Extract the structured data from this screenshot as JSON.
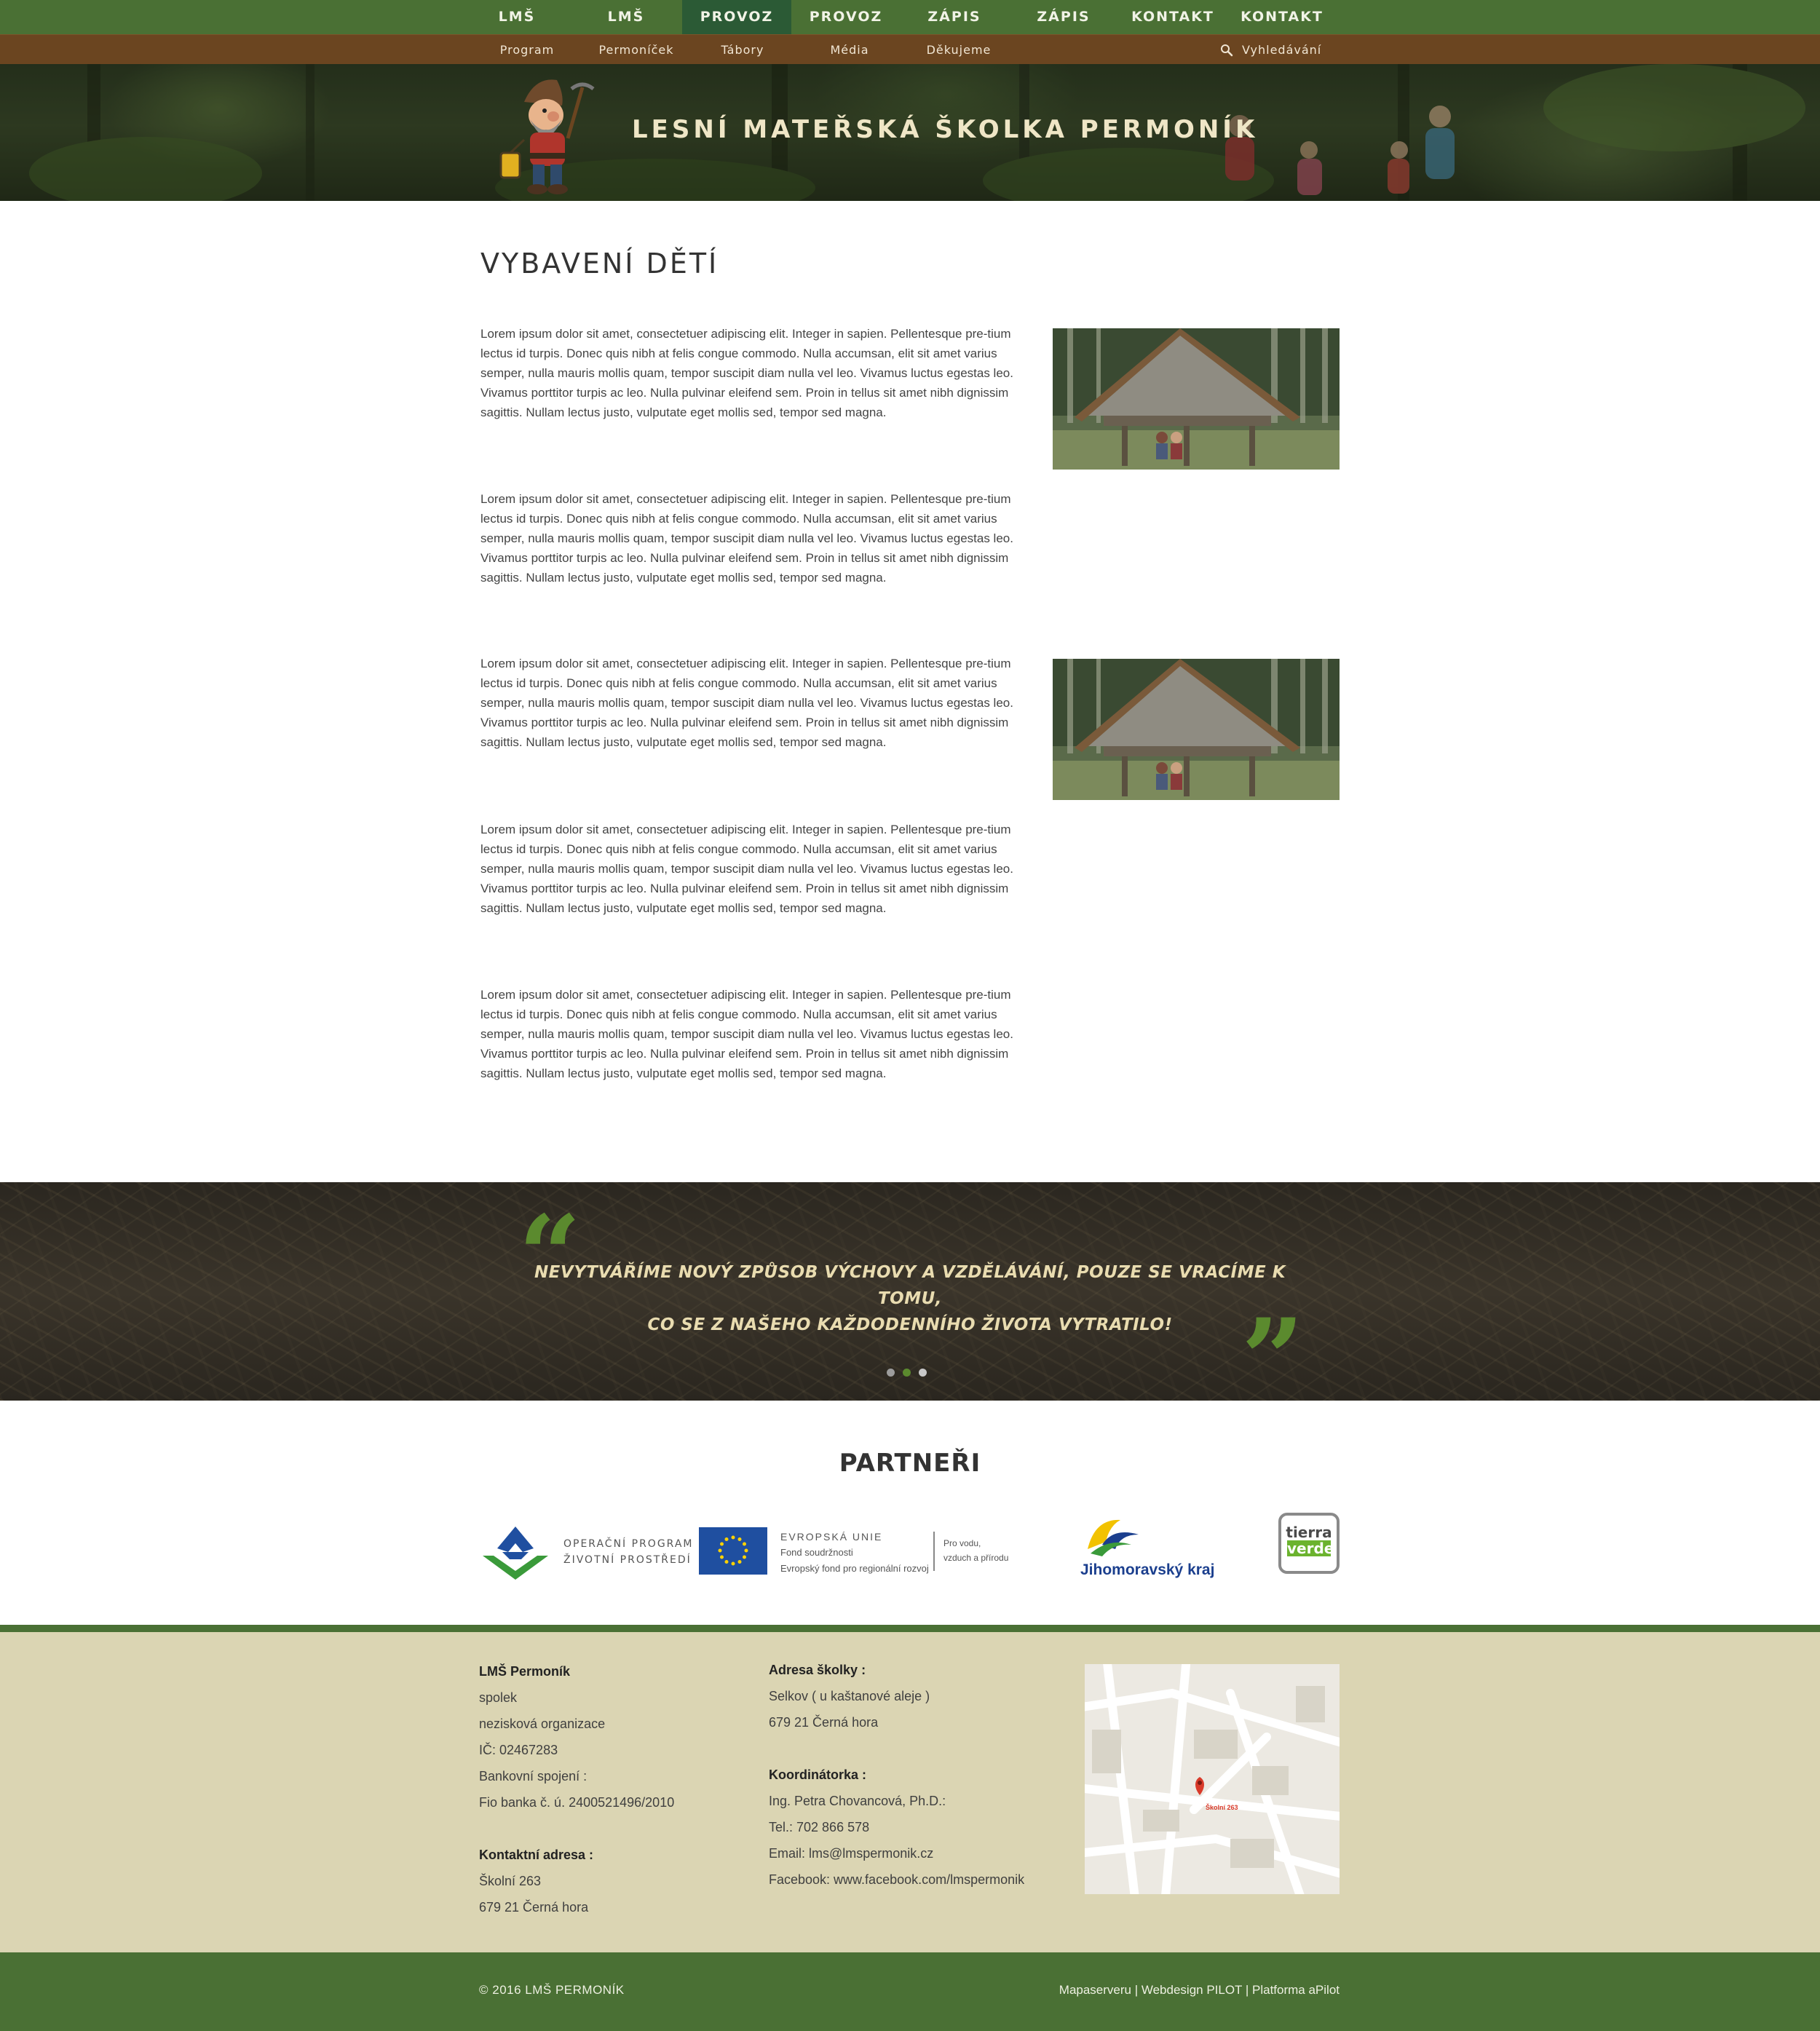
{
  "topnav": {
    "items": [
      "LMŠ",
      "LMŠ",
      "PROVOZ",
      "PROVOZ",
      "ZÁPIS",
      "ZÁPIS",
      "KONTAKT",
      "KONTAKT"
    ],
    "active_index": 2
  },
  "subnav": {
    "items": [
      "Program",
      "Permoníček",
      "Tábory",
      "Média",
      "Děkujeme"
    ],
    "search_label": "Vyhledávání"
  },
  "header": {
    "title": "LESNÍ MATEŘSKÁ ŠKOLKA PERMONÍK"
  },
  "content": {
    "title": "VYBAVENÍ DĚTÍ",
    "paragraphs": [
      "Lorem ipsum dolor sit amet, consectetuer adipiscing elit. Integer in sapien. Pellentesque pre-tium lectus id turpis. Donec quis nibh at felis congue commodo. Nulla accumsan, elit sit amet varius semper, nulla mauris mollis quam, tempor suscipit diam nulla vel leo. Vivamus luctus egestas leo. Vivamus porttitor turpis ac leo. Nulla pulvinar eleifend sem. Proin in tellus sit amet nibh dignissim sagittis. Nullam lectus justo, vulputate eget mollis sed, tempor sed magna.",
      "Lorem ipsum dolor sit amet, consectetuer adipiscing elit. Integer in sapien. Pellentesque pre-tium lectus id turpis. Donec quis nibh at felis congue commodo. Nulla accumsan, elit sit amet varius semper, nulla mauris mollis quam, tempor suscipit diam nulla vel leo. Vivamus luctus egestas leo. Vivamus porttitor turpis ac leo. Nulla pulvinar eleifend sem. Proin in tellus sit amet nibh dignissim sagittis. Nullam lectus justo, vulputate eget mollis sed, tempor sed magna.",
      "Lorem ipsum dolor sit amet, consectetuer adipiscing elit. Integer in sapien. Pellentesque pre-tium lectus id turpis. Donec quis nibh at felis congue commodo. Nulla accumsan, elit sit amet varius semper, nulla mauris mollis quam, tempor suscipit diam nulla vel leo. Vivamus luctus egestas leo. Vivamus porttitor turpis ac leo. Nulla pulvinar eleifend sem. Proin in tellus sit amet nibh dignissim sagittis. Nullam lectus justo, vulputate eget mollis sed, tempor sed magna.",
      "Lorem ipsum dolor sit amet, consectetuer adipiscing elit. Integer in sapien. Pellentesque pre-tium lectus id turpis. Donec quis nibh at felis congue commodo. Nulla accumsan, elit sit amet varius semper, nulla mauris mollis quam, tempor suscipit diam nulla vel leo. Vivamus luctus egestas leo. Vivamus porttitor turpis ac leo. Nulla pulvinar eleifend sem. Proin in tellus sit amet nibh dignissim sagittis. Nullam lectus justo, vulputate eget mollis sed, tempor sed magna.",
      "Lorem ipsum dolor sit amet, consectetuer adipiscing elit. Integer in sapien. Pellentesque pre-tium lectus id turpis. Donec quis nibh at felis congue commodo. Nulla accumsan, elit sit amet varius semper, nulla mauris mollis quam, tempor suscipit diam nulla vel leo. Vivamus luctus egestas leo. Vivamus porttitor turpis ac leo. Nulla pulvinar eleifend sem. Proin in tellus sit amet nibh dignissim sagittis. Nullam lectus justo, vulputate eget mollis sed, tempor sed magna."
    ]
  },
  "quote": {
    "line1": "NEVYTVÁŘÍME NOVÝ ZPŮSOB VÝCHOVY A VZDĚLÁVÁNÍ, POUZE SE VRACÍME K TOMU,",
    "line2": "CO SE Z NAŠEHO KAŽDODENNÍHO ŽIVOTA VYTRATILO!",
    "slides": 3,
    "active_slide": 1
  },
  "partners": {
    "title": "PARTNEŘI",
    "op_line1": "OPERAČNÍ PROGRAM",
    "op_line2": "ŽIVOTNÍ PROSTŘEDÍ",
    "eu_heading": "EVROPSKÁ UNIE",
    "eu_line1": "Fond soudržnosti",
    "eu_line2": "Evropský fond pro regionální rozvoj",
    "eu_side1": "Pro vodu,",
    "eu_side2": "vzduch a přírodu",
    "jmk": "Jihomoravský kraj",
    "tierra1": "tierra",
    "tierra2": "verde"
  },
  "footer": {
    "col1": {
      "org": "LMŠ Permoník",
      "lines": [
        "spolek",
        "nezisková organizace",
        "IČ: 02467283",
        "Bankovní spojení :",
        "Fio banka č. ú. 2400521496/2010"
      ],
      "contact_heading": "Kontaktní adresa :",
      "contact_lines": [
        "Školní 263",
        "679 21 Černá hora"
      ]
    },
    "col2": {
      "address_heading": "Adresa školky :",
      "address_lines": [
        "Selkov ( u kaštanové aleje )",
        "679 21 Černá hora"
      ],
      "coord_heading": "Koordinátorka :",
      "coord_lines": [
        "Ing. Petra Chovancová, Ph.D.:",
        "Tel.: 702 866 578",
        "Email: lms@lmspermonik.cz",
        "Facebook: www.facebook.com/lmspermonik"
      ]
    },
    "map_pin_label": "Školní 263"
  },
  "bottom": {
    "copyright": "© 2016 LMŠ PERMONÍK",
    "credits": "Mapaserveru | Webdesign PILOT | Platforma aPilot"
  },
  "colors": {
    "nav_green": "#4a7034",
    "nav_active": "#2b5a35",
    "subnav_brown": "#6b4520",
    "quote_green": "#5b8a2e",
    "footer_beige": "#dbd5b3"
  }
}
